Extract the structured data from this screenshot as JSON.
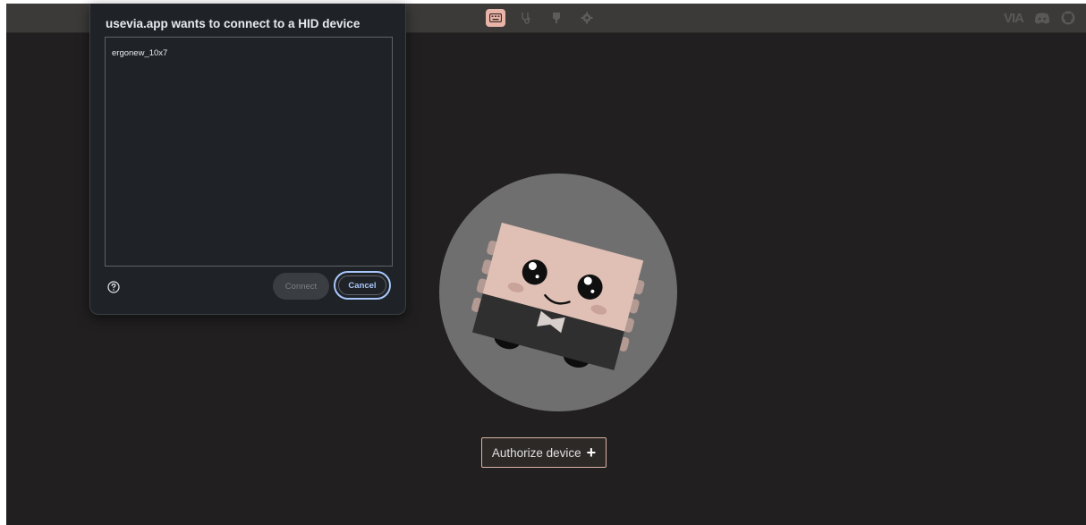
{
  "dialog": {
    "title": "usevia.app wants to connect to a HID device",
    "devices": [
      "ergonew_10x7"
    ],
    "connect_label": "Connect",
    "cancel_label": "Cancel"
  },
  "topbar": {
    "nav_icons": [
      "keyboard-icon",
      "stethoscope-icon",
      "design-icon",
      "settings-icon"
    ],
    "active_tab": "keyboard-icon",
    "brand": "VIA",
    "right_icons": [
      "discord-icon",
      "github-icon"
    ]
  },
  "main": {
    "authorize_label": "Authorize device",
    "authorize_symbol": "+"
  },
  "colors": {
    "background": "#211f1f",
    "accent": "#e8b4a8",
    "dialog_bg": "#1f2328",
    "cancel_blue": "#a8c7fa"
  }
}
